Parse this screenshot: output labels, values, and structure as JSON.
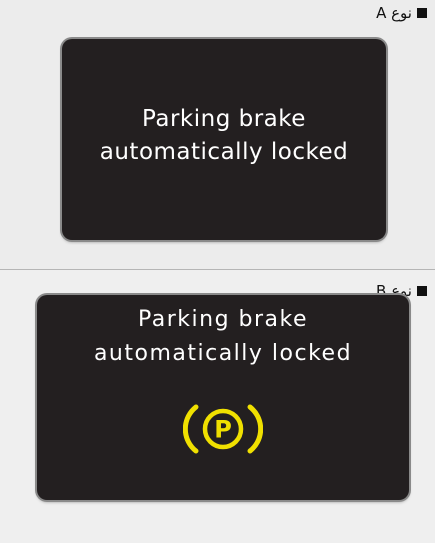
{
  "panels": [
    {
      "type_label": "نوع A",
      "message": [
        "Parking brake",
        "automatically locked"
      ]
    },
    {
      "type_label": "نوع B",
      "message": [
        "Parking brake",
        "automatically locked"
      ],
      "icon": "parking-brake-icon",
      "icon_letter": "P",
      "icon_color": "#f0e000"
    }
  ],
  "colors": {
    "display_background": "#231f20",
    "message_text": "#ffffff",
    "page_background": "#ececec"
  }
}
